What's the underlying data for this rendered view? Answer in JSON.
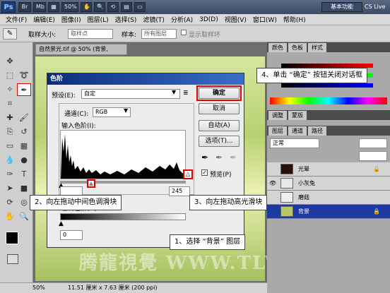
{
  "titlebar": {
    "ps_logo": "Ps",
    "essentials_label": "基本功能",
    "cslive_label": "CS Live"
  },
  "menu": [
    "文件(F)",
    "编辑(E)",
    "图像(I)",
    "图层(L)",
    "选择(S)",
    "滤镜(T)",
    "分析(A)",
    "3D(D)",
    "视图(V)",
    "窗口(W)",
    "帮助(H)"
  ],
  "options": {
    "sample_size_label": "取样大小:",
    "sample_size_value": "取样点",
    "sample_label": "样本:",
    "sample_value": "所有图层",
    "show_ring_label": "显示取样环"
  },
  "document": {
    "tab_title": "自然景光.tif @ 50% (背景, RGB/8)",
    "zoom": "50%",
    "status": "11.51 厘米 x 7.63 厘米 (200 ppi)"
  },
  "dialog": {
    "title": "色阶",
    "preset_label": "预设(E):",
    "preset_value": "自定",
    "channel_label": "通道(C):",
    "channel_value": "RGB",
    "input_levels_label": "输入色阶(I):",
    "output_levels_label": "输出色阶(O):",
    "input_highlight_value": "245",
    "output_shadow_value": "0",
    "ok_label": "确定",
    "cancel_label": "取消",
    "auto_label": "自动(A)",
    "options_label": "选项(T)...",
    "preview_label": "预览(P)"
  },
  "panel": {
    "top_tabs": [
      "颜色",
      "色板",
      "样式"
    ],
    "adjust_tabs": [
      "调整",
      "蒙版"
    ],
    "layer_tabs": [
      "图层",
      "通道",
      "路径"
    ],
    "blend_mode": "正常",
    "layers": [
      {
        "name": "光晕",
        "visible": false,
        "locked": true
      },
      {
        "name": "小灰兔",
        "visible": true,
        "locked": false
      },
      {
        "name": "磨菇",
        "visible": false,
        "locked": false
      },
      {
        "name": "背景",
        "visible": false,
        "locked": true,
        "selected": true
      }
    ]
  },
  "callouts": {
    "step1": "1、选择 “背景” 图层",
    "step2": "2、向左拖动中间色调滑块",
    "step3": "3、向左拖动高光滑块",
    "step4": "4、单击 “确定” 按钮关闭对话框"
  },
  "watermark": "腾龍視覺 WWW.TLVI.NET",
  "colors": {
    "accent_red": "#e10000",
    "dialog_title": "#0a2d7a",
    "selected_layer": "#1c3aa0"
  }
}
